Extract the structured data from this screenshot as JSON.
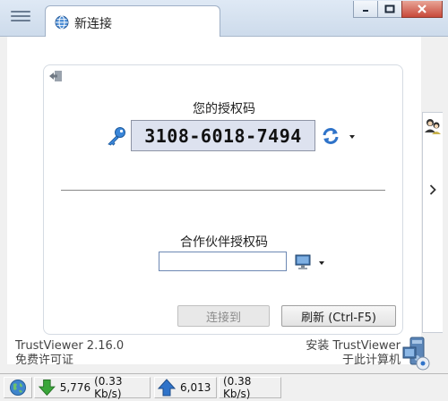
{
  "tab": {
    "title": "新连接"
  },
  "main": {
    "your_code_label": "您的授权码",
    "your_code": "3108-6018-7494",
    "partner_label": "合作伙伴授权码",
    "partner_value": "",
    "connect_button": "连接到",
    "refresh_button": "刷新 (Ctrl-F5)"
  },
  "footer": {
    "version": "TrustViewer 2.16.0",
    "license": "免费许可证",
    "install_line1": "安装 TrustViewer",
    "install_line2": "于此计算机"
  },
  "status_bar": {
    "download_bytes": "5,776",
    "download_rate": "(0.33 Kb/s)",
    "upload_bytes": "6,013",
    "upload_rate": "(0.38 Kb/s)"
  },
  "colors": {
    "accent": "#2f73c9",
    "download_arrow": "#3aa63a",
    "upload_arrow": "#2f73c9",
    "close_button": "#c8493a"
  },
  "icons": {
    "menu": "hamburger-menu-icon",
    "tab": "globe-icon",
    "exit": "exit-door-icon",
    "key": "key-icon",
    "refresh": "refresh-arrows-icon",
    "monitor": "monitor-icon",
    "contacts": "contacts-people-icon",
    "install": "install-computer-icon",
    "network": "network-globe-icon",
    "download": "down-arrow-icon",
    "upload": "up-arrow-icon"
  }
}
